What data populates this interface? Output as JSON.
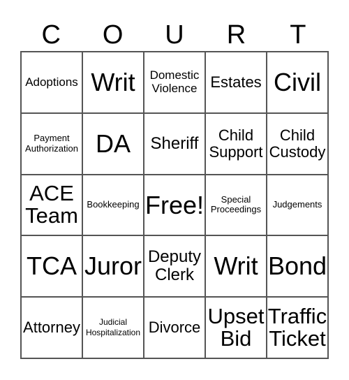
{
  "title_letters": [
    "C",
    "O",
    "U",
    "R",
    "T"
  ],
  "cells": [
    [
      "Adoptions",
      "Writ",
      "Domestic Violence",
      "Estates",
      "Civil"
    ],
    [
      "Payment Authorization",
      "DA",
      "Sheriff",
      "Child Support",
      "Child Custody"
    ],
    [
      "ACE Team",
      "Bookkeeping",
      "Free!",
      "Special Proceedings",
      "Judgements"
    ],
    [
      "TCA",
      "Juror",
      "Deputy Clerk",
      "Writ",
      "Bond"
    ],
    [
      "Attorney",
      "Judicial Hospitalization",
      "Divorce",
      "Upset Bid",
      "Traffic Ticket"
    ]
  ]
}
